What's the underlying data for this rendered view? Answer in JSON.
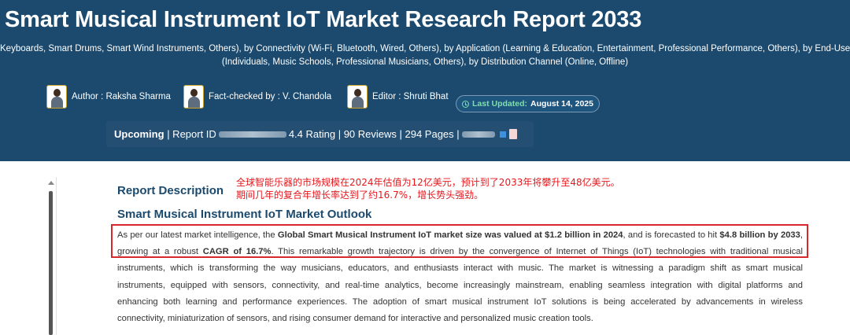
{
  "header": {
    "title": "Smart Musical Instrument IoT Market Research Report 2033",
    "subtitle_lines": [
      "Keyboards, Smart Drums, Smart Wind Instruments, Others), by Connectivity (Wi-Fi, Bluetooth, Wired, Others), by Application (Learning & Education, Entertainment, Professional Performance, Others), by End-User",
      "(Individuals, Music Schools, Professional Musicians, Others), by Distribution Channel (Online, Offline)"
    ]
  },
  "credits": {
    "author": "Author : Raksha Sharma",
    "fact_checked": "Fact-checked by : V. Chandola",
    "editor": "Editor : Shruti Bhat"
  },
  "last_updated": {
    "label": "Last Updated:",
    "value": "August 14, 2025"
  },
  "meta": {
    "status": "Upcoming",
    "report_id_label": "| Report ID",
    "rating": "4.4 Rating",
    "reviews": "| 90 Reviews",
    "pages": "| 294 Pages |"
  },
  "content": {
    "section_title": "Report Description",
    "annotation_lines": [
      "全球智能乐器的市场规模在2024年估值为12亿美元，预计到了2033年将攀升至48亿美元。",
      "期间几年的复合年增长率达到了约16.7%，增长势头强劲。"
    ],
    "outlook_title": "Smart Musical Instrument IoT Market Outlook",
    "para_lead": "As per our latest market intelligence, the ",
    "para_bold1": "Global Smart Musical Instrument IoT market size was valued at $1.2 billion in 2024",
    "para_mid1": ", and is forecasted to hit ",
    "para_bold2": "$4.8 billion by 2033",
    "para_mid2": ",",
    "para_l2_lead": "growing at a robust ",
    "para_bold3": "CAGR of 16.7%",
    "para_l2_rest": ". This remarkable growth trajectory is driven by the convergence of Internet of Things (IoT) technologies with traditional musical",
    "para_lines": [
      "instruments, which is transforming the way musicians, educators, and enthusiasts interact with music. The market is witnessing a paradigm shift as smart musical",
      "instruments, equipped with sensors, connectivity, and real-time analytics, become increasingly mainstream, enabling seamless integration with digital platforms and",
      "enhancing both learning and performance experiences. The adoption of smart musical instrument IoT solutions is being accelerated by advancements in wireless",
      "connectivity, miniaturization of sensors, and rising consumer demand for interactive and personalized music creation tools."
    ]
  },
  "colors": {
    "header_bg": "#1b4a6e",
    "accent_green": "#7ee0a8",
    "highlight_red": "#d9272e"
  }
}
